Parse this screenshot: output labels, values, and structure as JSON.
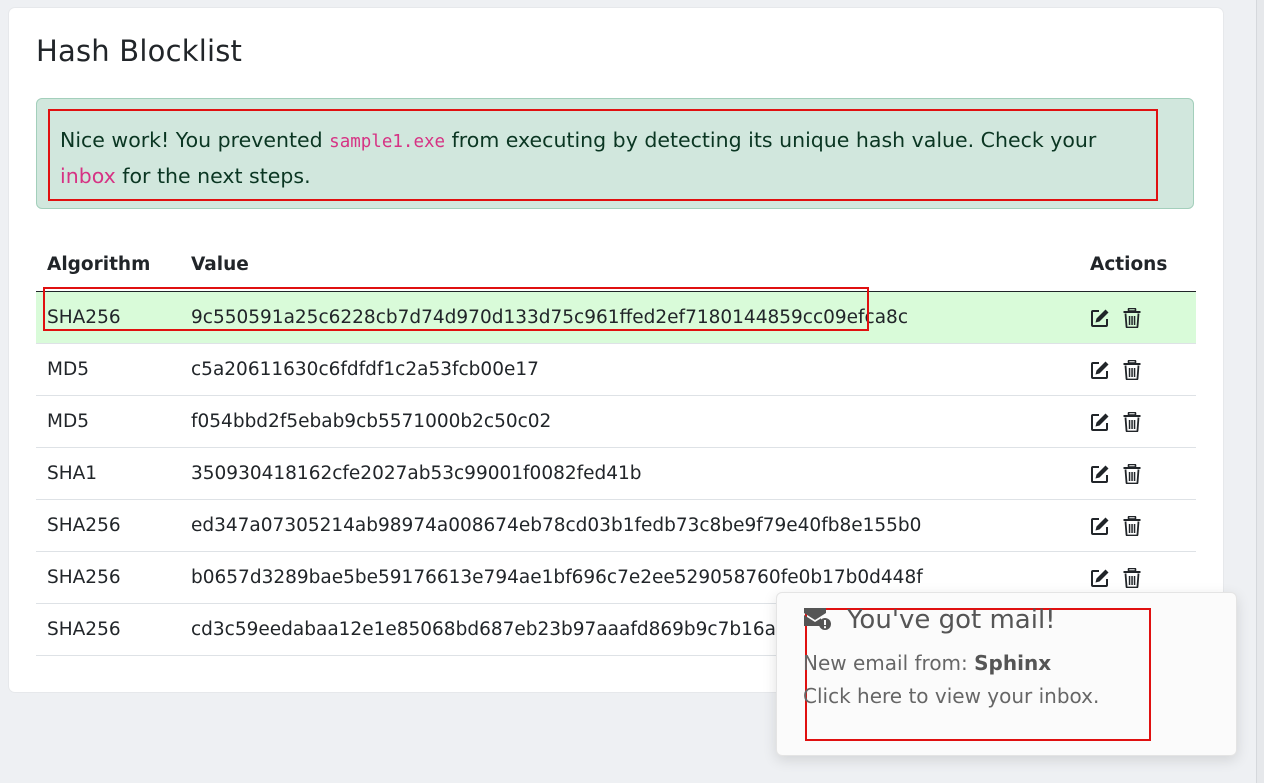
{
  "page": {
    "title": "Hash Blocklist"
  },
  "alert": {
    "text_before": "Nice work! You prevented ",
    "filename": "sample1.exe",
    "text_middle": " from executing by detecting its unique hash value. Check your ",
    "link": "inbox",
    "text_after": " for the next steps."
  },
  "table": {
    "headers": {
      "algorithm": "Algorithm",
      "value": "Value",
      "actions": "Actions"
    },
    "rows": [
      {
        "algorithm": "SHA256",
        "value": "9c550591a25c6228cb7d74d970d133d75c961ffed2ef7180144859cc09efca8c",
        "highlighted": true
      },
      {
        "algorithm": "MD5",
        "value": "c5a20611630c6fdfdf1c2a53fcb00e17"
      },
      {
        "algorithm": "MD5",
        "value": "f054bbd2f5ebab9cb5571000b2c50c02"
      },
      {
        "algorithm": "SHA1",
        "value": "350930418162cfe2027ab53c99001f0082fed41b"
      },
      {
        "algorithm": "SHA256",
        "value": "ed347a07305214ab98974a008674eb78cd03b1fedb73c8be9f79e40fb8e155b0"
      },
      {
        "algorithm": "SHA256",
        "value": "b0657d3289bae5be59176613e794ae1bf696c7e2ee529058760fe0b17b0d448f"
      },
      {
        "algorithm": "SHA256",
        "value": "cd3c59eedabaa12e1e85068bd687eb23b97aaafd869b9c7b16a96c2"
      }
    ],
    "action_icons": [
      "edit-icon",
      "trash-icon"
    ]
  },
  "toast": {
    "title": "You've got mail!",
    "from_label": "New email from: ",
    "from_name": "Sphinx",
    "cta": "Click here to view your inbox.",
    "icon": "mail-alert-icon"
  },
  "colors": {
    "alert_bg": "#d1e7dd",
    "highlight_row": "#d9fbd9",
    "annotation_red": "#e01010",
    "code_pink": "#d63384"
  }
}
